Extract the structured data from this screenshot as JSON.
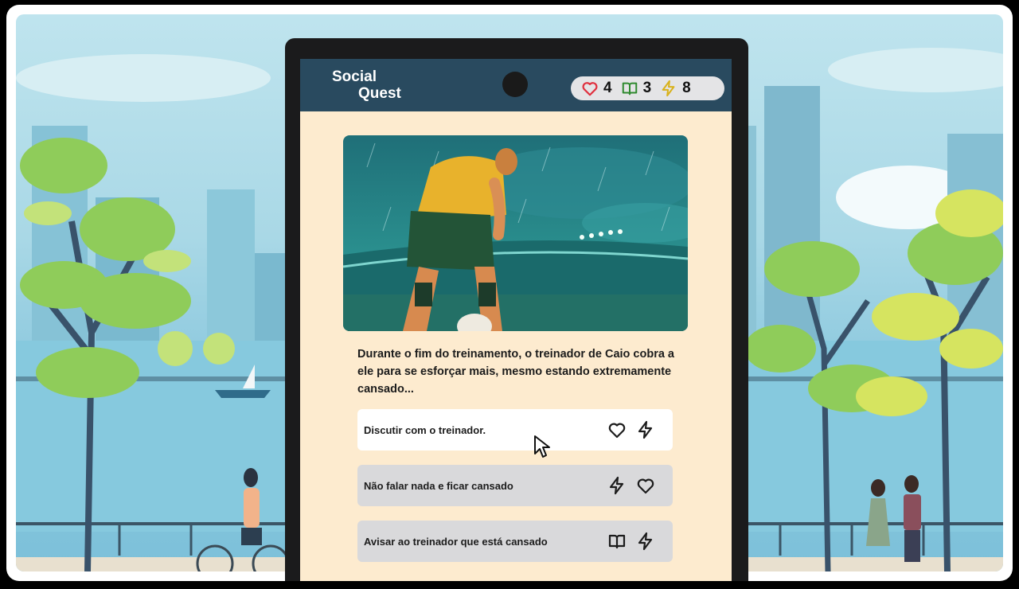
{
  "app": {
    "logo_line1": "Social",
    "logo_line2": "Quest"
  },
  "stats": [
    {
      "icon": "heart-icon",
      "value": "4",
      "color": "#e0313f"
    },
    {
      "icon": "book-icon",
      "value": "3",
      "color": "#2f8a2f"
    },
    {
      "icon": "lightning-icon",
      "value": "8",
      "color": "#d9b21c"
    }
  ],
  "story": {
    "text": "Durante o fim do treinamento, o treinador de Caio cobra a ele para se esforçar mais, mesmo estando extremamente cansado..."
  },
  "choices": [
    {
      "label": "Discutir com o treinador.",
      "icons": [
        "heart-icon",
        "lightning-icon"
      ]
    },
    {
      "label": "Não falar nada e ficar cansado",
      "icons": [
        "lightning-icon",
        "heart-icon"
      ]
    },
    {
      "label": "Avisar ao treinador que está cansado",
      "icons": [
        "book-icon",
        "lightning-icon"
      ]
    }
  ],
  "colors": {
    "topbar": "#294a5f",
    "screen_bg": "#fdebcf",
    "selected_choice": "#ffffff",
    "choice": "#d9d9db"
  }
}
